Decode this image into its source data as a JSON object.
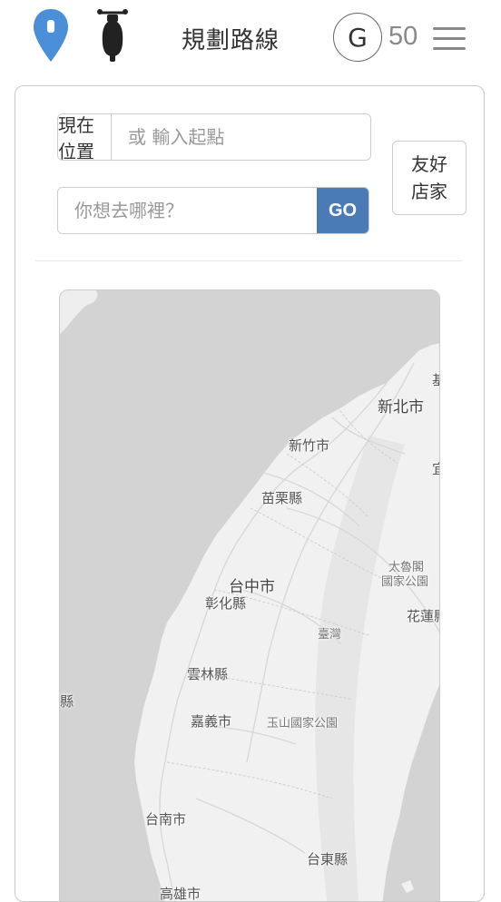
{
  "header": {
    "title": "規劃路線",
    "badge_letter": "G",
    "points": "50",
    "pin_icon": "location-pin-icon",
    "scooter_icon": "scooter-icon",
    "menu_icon": "hamburger-menu-icon"
  },
  "route_form": {
    "current_location_label": "現在位置",
    "start_placeholder": "或 輸入起點",
    "destination_placeholder": "你想去哪裡？",
    "go_label": "GO",
    "friendly_stores_line1": "友好",
    "friendly_stores_line2": "店家"
  },
  "colors": {
    "accent": "#4a7bb7",
    "pin": "#4a8fd8"
  },
  "map": {
    "labels": {
      "new_taipei": "新北市",
      "keelung_partial": "基",
      "yilan_partial": "宜",
      "hsinchu": "新竹市",
      "miaoli": "苗栗縣",
      "taichung": "台中市",
      "changhua": "彰化縣",
      "taroko_1": "太魯閣",
      "taroko_2": "國家公園",
      "hualien": "花蓮縣",
      "taiwan": "臺灣",
      "yunlin": "雲林縣",
      "edge_county": "縣",
      "chiayi": "嘉義市",
      "yushan": "玉山國家公園",
      "tainan": "台南市",
      "taitung": "台東縣",
      "kaohsiung": "高雄市"
    }
  }
}
